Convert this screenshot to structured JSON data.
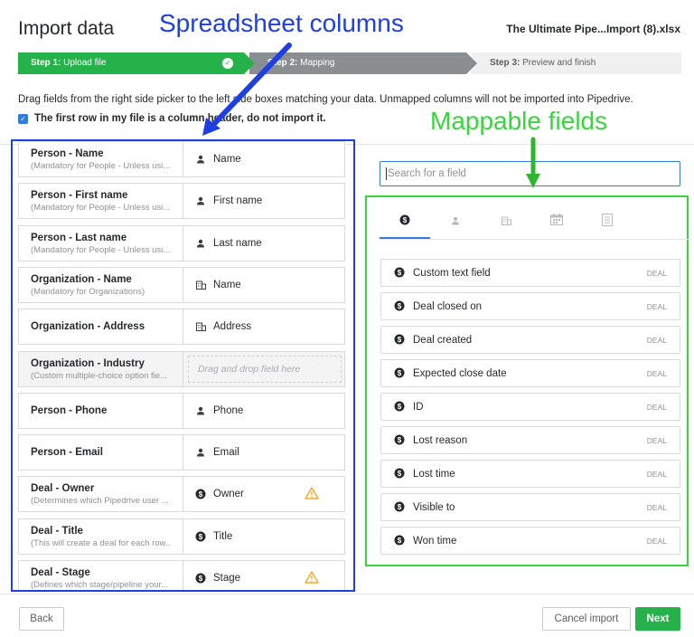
{
  "header": {
    "title": "Import data",
    "filename": "The Ultimate Pipe...Import (8).xlsx"
  },
  "steps": [
    {
      "prefix": "Step 1:",
      "label": "Upload file"
    },
    {
      "prefix": "Step 2:",
      "label": "Mapping"
    },
    {
      "prefix": "Step 3:",
      "label": "Preview and finish"
    }
  ],
  "instructions": "Drag fields from the right side picker to the left side boxes matching your data. Unmapped columns will not be imported into Pipedrive.",
  "header_row_checkbox": "The first row in my file is a column header, do not import it.",
  "annotations": {
    "left": "Spreadsheet columns",
    "right": "Mappable fields"
  },
  "mapping_rows": [
    {
      "column": "Person - Name",
      "desc": "(Mandatory for People - Unless usi...",
      "field": "Name",
      "icon": "person-icon"
    },
    {
      "column": "Person - First name",
      "desc": "(Mandatory for People - Unless usi...",
      "field": "First name",
      "icon": "person-icon"
    },
    {
      "column": "Person - Last name",
      "desc": "(Mandatory for People - Unless usi...",
      "field": "Last name",
      "icon": "person-icon"
    },
    {
      "column": "Organization - Name",
      "desc": "(Mandatory for Organizations)",
      "field": "Name",
      "icon": "organization-icon"
    },
    {
      "column": "Organization - Address",
      "desc": "",
      "field": "Address",
      "icon": "organization-icon"
    },
    {
      "column": "Organization - Industry",
      "desc": "(Custom multiple-choice option fie...",
      "field": "",
      "placeholder": "Drag and drop field here"
    },
    {
      "column": "Person - Phone",
      "desc": "",
      "field": "Phone",
      "icon": "person-icon"
    },
    {
      "column": "Person - Email",
      "desc": "",
      "field": "Email",
      "icon": "person-icon"
    },
    {
      "column": "Deal - Owner",
      "desc": "(Determines which Pipedrive user ...",
      "field": "Owner",
      "icon": "deal-icon",
      "warning": true
    },
    {
      "column": "Deal - Title",
      "desc": "(This will create a deal for each row..",
      "field": "Title",
      "icon": "deal-icon"
    },
    {
      "column": "Deal - Stage",
      "desc": "(Defines which stage/pipeline your...",
      "field": "Stage",
      "icon": "deal-icon",
      "warning": true
    }
  ],
  "search": {
    "placeholder": "Search for a field"
  },
  "tabs": [
    "deal-icon",
    "person-icon",
    "organization-icon",
    "calendar-icon",
    "note-icon"
  ],
  "fields": [
    {
      "label": "Custom text field",
      "tag": "DEAL"
    },
    {
      "label": "Deal closed on",
      "tag": "DEAL"
    },
    {
      "label": "Deal created",
      "tag": "DEAL"
    },
    {
      "label": "Expected close date",
      "tag": "DEAL"
    },
    {
      "label": "ID",
      "tag": "DEAL"
    },
    {
      "label": "Lost reason",
      "tag": "DEAL"
    },
    {
      "label": "Lost time",
      "tag": "DEAL"
    },
    {
      "label": "Visible to",
      "tag": "DEAL"
    },
    {
      "label": "Won time",
      "tag": "DEAL"
    }
  ],
  "footer": {
    "back": "Back",
    "cancel": "Cancel import",
    "next": "Next"
  },
  "colors": {
    "green": "#25b24a",
    "blue": "#317ae2",
    "annotation_blue": "#1f3fe0",
    "annotation_green": "#37d63b",
    "warning": "#f5a623"
  }
}
